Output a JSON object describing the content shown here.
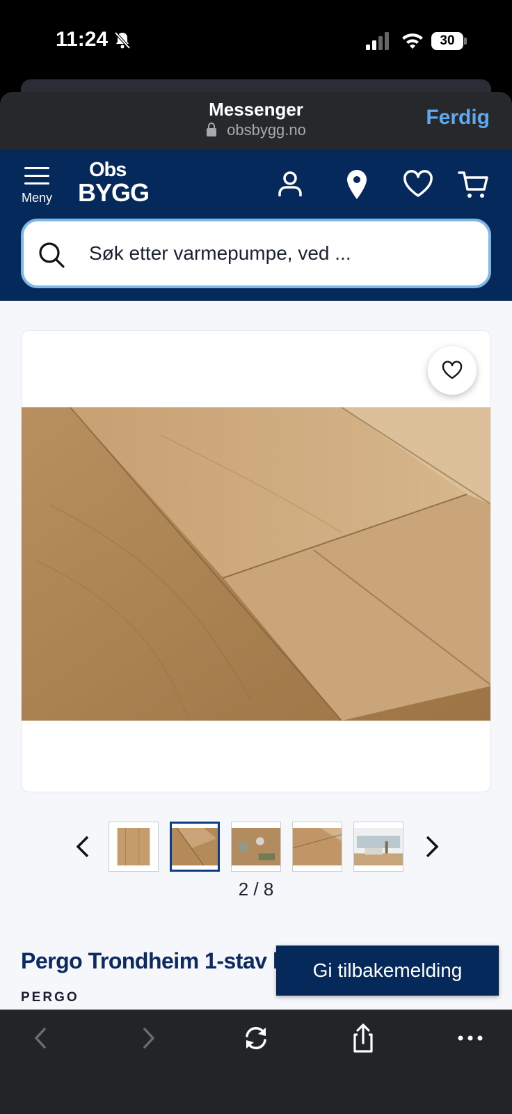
{
  "status_bar": {
    "time": "11:24",
    "battery": "30",
    "icons": [
      "bell-slash-icon",
      "signal-icon",
      "wifi-icon",
      "battery-icon"
    ]
  },
  "sheet": {
    "title": "Messenger",
    "url": "obsbygg.no",
    "done_label": "Ferdig"
  },
  "header": {
    "menu_label": "Meny",
    "logo_top": "Obs",
    "logo_bottom": "BYGG",
    "icons": [
      "user-icon",
      "location-pin-icon",
      "heart-icon",
      "cart-icon"
    ],
    "search_placeholder": "Søk etter varmepumpe, ved ..."
  },
  "product": {
    "gallery_counter": "2 / 8",
    "title": "Pergo Trondheim 1-stav laminat",
    "brand": "PERGO",
    "thumbnails": [
      "oak plank sample",
      "oak floor close-up",
      "room with oak floor top view",
      "oak floor planks",
      "living room with oak floor"
    ],
    "active_thumbnail": 1
  },
  "feedback": {
    "label": "Gi tilbakemelding"
  },
  "colors": {
    "brand_navy": "#05295a",
    "title_navy": "#0b2a60",
    "link_blue": "#5ea9f2",
    "search_border": "#7fb8e6"
  }
}
